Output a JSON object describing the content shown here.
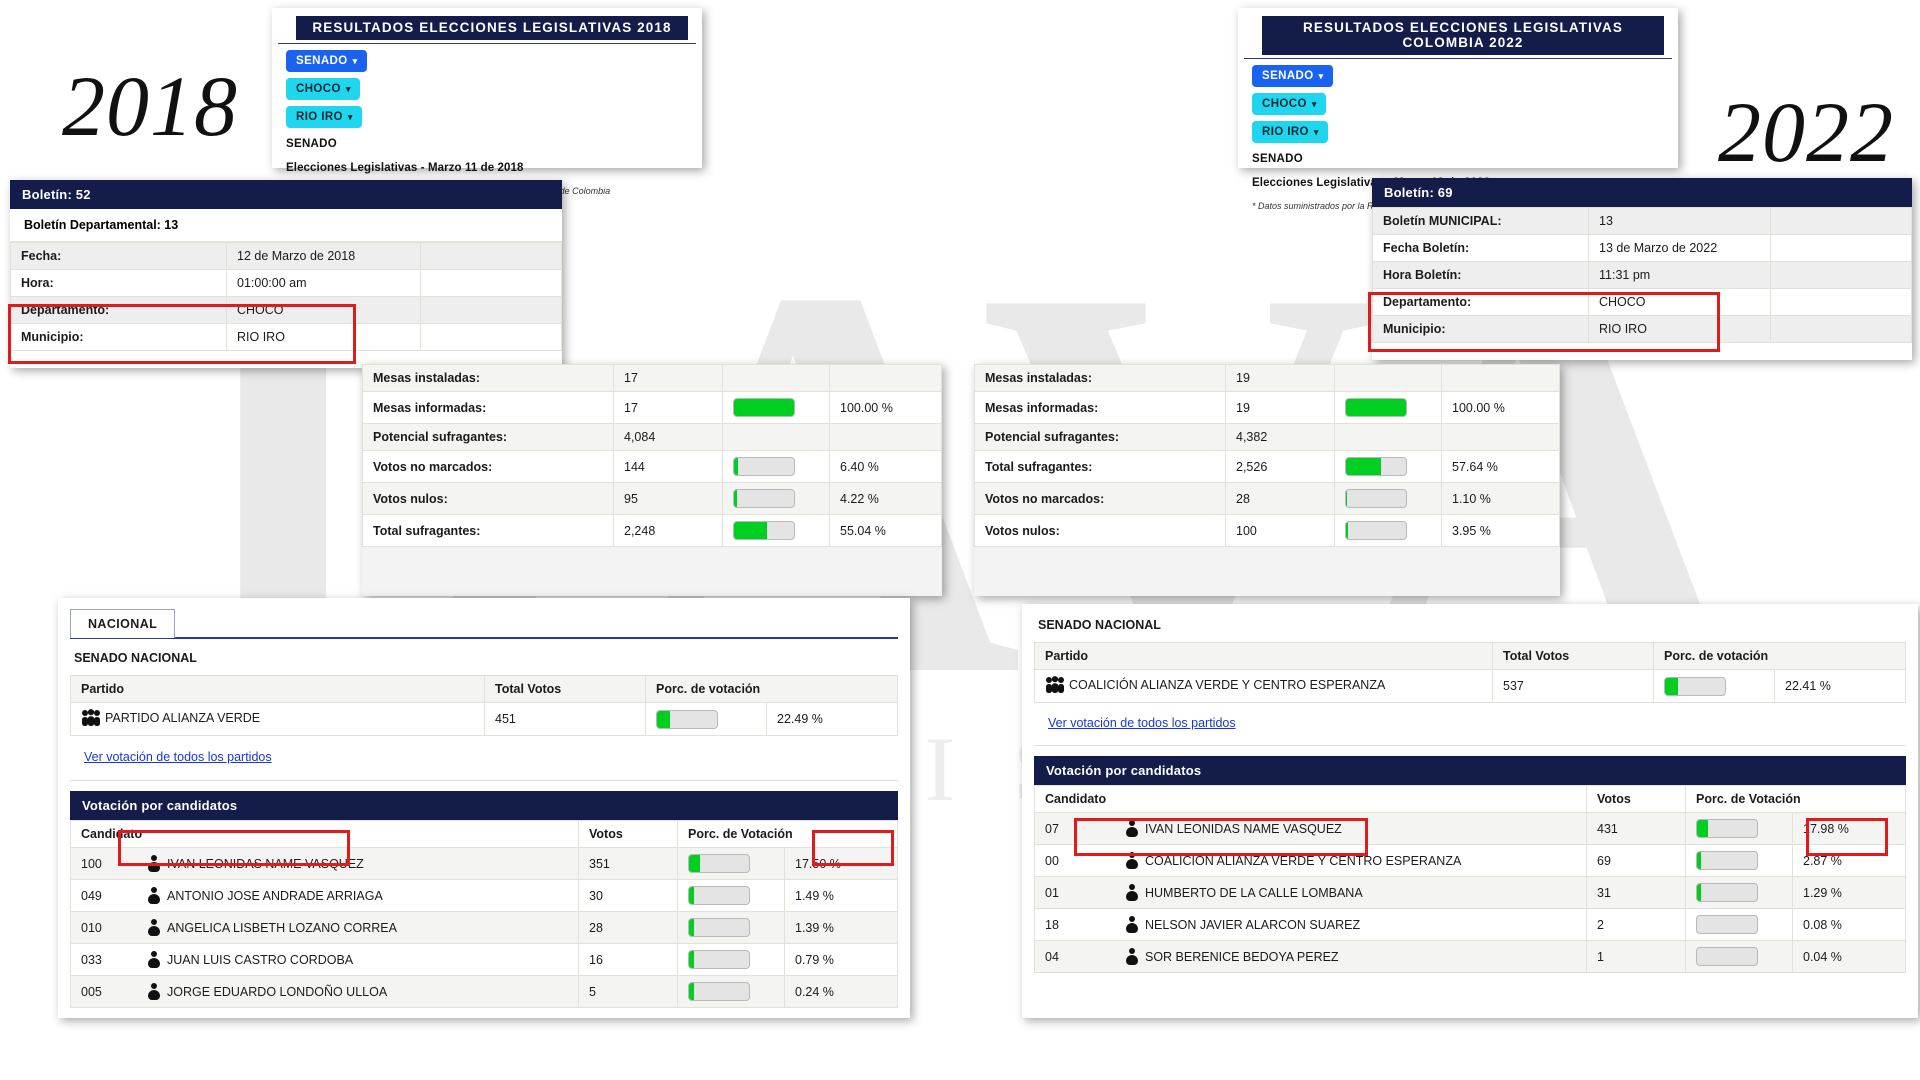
{
  "watermark": {
    "big": "DAVA",
    "small": "REVISTA"
  },
  "years": {
    "left": "2018",
    "right": "2022"
  },
  "left": {
    "header": {
      "title": "RESULTADOS ELECCIONES LEGISLATIVAS 2018",
      "crumbs": [
        {
          "label": "SENADO",
          "caret": "▾",
          "color": "#1a62f0"
        },
        {
          "label": "CHOCO",
          "caret": "▾",
          "color": "#1fd6ee"
        },
        {
          "label": "RIO IRO",
          "caret": "▾",
          "color": "#1fd6ee"
        }
      ],
      "corporation": "SENADO",
      "election_line": "Elecciones Legislativas - Marzo 11 de 2018",
      "note": "* Datos suministrados por la Registraduría Nacional del Estado Civil de Colombia"
    },
    "boletin": {
      "title": "Boletín: 52",
      "subtitle": "Boletín Departamental: 13",
      "rows": [
        {
          "label": "Fecha:",
          "value": "12 de Marzo de 2018"
        },
        {
          "label": "Hora:",
          "value": "01:00:00 am"
        },
        {
          "label": "Departamento:",
          "value": "CHOCO"
        },
        {
          "label": "Municipio:",
          "value": "RIO IRO"
        }
      ]
    },
    "mesas": [
      {
        "label": "Mesas instaladas:",
        "value": "17",
        "bar": null,
        "pct": ""
      },
      {
        "label": "Mesas informadas:",
        "value": "17",
        "bar": 100,
        "pct": "100.00 %"
      },
      {
        "label": "Potencial sufragantes:",
        "value": "4,084",
        "bar": null,
        "pct": ""
      },
      {
        "label": "Votos no marcados:",
        "value": "144",
        "bar": 6.4,
        "pct": "6.40 %"
      },
      {
        "label": "Votos nulos:",
        "value": "95",
        "bar": 4.22,
        "pct": "4.22 %"
      },
      {
        "label": "Total sufragantes:",
        "value": "2,248",
        "bar": 55.04,
        "pct": "55.04 %"
      }
    ],
    "tab_label": "NACIONAL",
    "senado_title": "SENADO NACIONAL",
    "party_headers": [
      "Partido",
      "Total Votos",
      "Porc. de votación"
    ],
    "party_row": {
      "name": "PARTIDO ALIANZA VERDE",
      "votes": "451",
      "bar": 22.49,
      "pct": "22.49 %"
    },
    "see_all_link": "Ver votación de todos los partidos",
    "cand_banner": "Votación por candidatos",
    "cand_headers": [
      "Candidato",
      "Votos",
      "Porc. de Votación"
    ],
    "candidates": [
      {
        "code": "100",
        "name": "IVAN LEONIDAS NAME VASQUEZ",
        "votes": "351",
        "bar": 17.5,
        "pct": "17.50 %"
      },
      {
        "code": "049",
        "name": "ANTONIO JOSE ANDRADE ARRIAGA",
        "votes": "30",
        "bar": 8,
        "pct": "1.49 %"
      },
      {
        "code": "010",
        "name": "ANGELICA LISBETH LOZANO CORREA",
        "votes": "28",
        "bar": 8,
        "pct": "1.39 %"
      },
      {
        "code": "033",
        "name": "JUAN LUIS CASTRO CORDOBA",
        "votes": "16",
        "bar": 8,
        "pct": "0.79 %"
      },
      {
        "code": "005",
        "name": "JORGE EDUARDO LONDOÑO ULLOA",
        "votes": "5",
        "bar": 8,
        "pct": "0.24 %"
      }
    ]
  },
  "right": {
    "header": {
      "title": "RESULTADOS ELECCIONES LEGISLATIVAS COLOMBIA 2022",
      "crumbs": [
        {
          "label": "SENADO",
          "caret": "▾",
          "color": "#1a62f0"
        },
        {
          "label": "CHOCO",
          "caret": "▾",
          "color": "#1fd6ee"
        },
        {
          "label": "RIO IRO",
          "caret": "▾",
          "color": "#1fd6ee"
        }
      ],
      "corporation": "SENADO",
      "election_line": "Elecciones Legislativas - Marzo 13 de 2022",
      "note": "* Datos suministrados por la Registraduría Nacional del Estado Civil de Colombia"
    },
    "boletin": {
      "title": "Boletín: 69",
      "rows": [
        {
          "label": "Boletín MUNICIPAL:",
          "value": "13"
        },
        {
          "label": "Fecha Boletín:",
          "value": "13 de Marzo de 2022"
        },
        {
          "label": "Hora Boletín:",
          "value": "11:31 pm"
        },
        {
          "label": "Departamento:",
          "value": "CHOCO"
        },
        {
          "label": "Municipio:",
          "value": "RIO IRO"
        }
      ]
    },
    "mesas": [
      {
        "label": "Mesas instaladas:",
        "value": "19",
        "bar": null,
        "pct": ""
      },
      {
        "label": "Mesas informadas:",
        "value": "19",
        "bar": 100,
        "pct": "100.00 %"
      },
      {
        "label": "Potencial sufragantes:",
        "value": "4,382",
        "bar": null,
        "pct": ""
      },
      {
        "label": "Total sufragantes:",
        "value": "2,526",
        "bar": 57.64,
        "pct": "57.64 %"
      },
      {
        "label": "Votos no marcados:",
        "value": "28",
        "bar": 1.1,
        "pct": "1.10 %"
      },
      {
        "label": "Votos nulos:",
        "value": "100",
        "bar": 3.95,
        "pct": "3.95 %"
      }
    ],
    "senado_title": "SENADO NACIONAL",
    "party_headers": [
      "Partido",
      "Total Votos",
      "Porc. de votación"
    ],
    "party_row": {
      "name": "COALICIÓN ALIANZA VERDE Y CENTRO ESPERANZA",
      "votes": "537",
      "bar": 22.41,
      "pct": "22.41 %"
    },
    "see_all_link": "Ver votación de todos los partidos",
    "cand_banner": "Votación por candidatos",
    "cand_headers": [
      "Candidato",
      "Votos",
      "Porc. de Votación"
    ],
    "candidates": [
      {
        "code": "07",
        "name": "IVAN LEONIDAS NAME VASQUEZ",
        "votes": "431",
        "bar": 17.98,
        "pct": "17.98 %"
      },
      {
        "code": "00",
        "name": "COALICIÓN ALIANZA VERDE Y CENTRO ESPERANZA",
        "votes": "69",
        "bar": 7,
        "pct": "2.87 %"
      },
      {
        "code": "01",
        "name": "HUMBERTO DE LA CALLE LOMBANA",
        "votes": "31",
        "bar": 7,
        "pct": "1.29 %"
      },
      {
        "code": "18",
        "name": "NELSON JAVIER ALARCON SUAREZ",
        "votes": "2",
        "bar": 0,
        "pct": "0.08 %"
      },
      {
        "code": "04",
        "name": "SOR BERENICE BEDOYA PEREZ",
        "votes": "1",
        "bar": 0,
        "pct": "0.04 %"
      }
    ]
  }
}
